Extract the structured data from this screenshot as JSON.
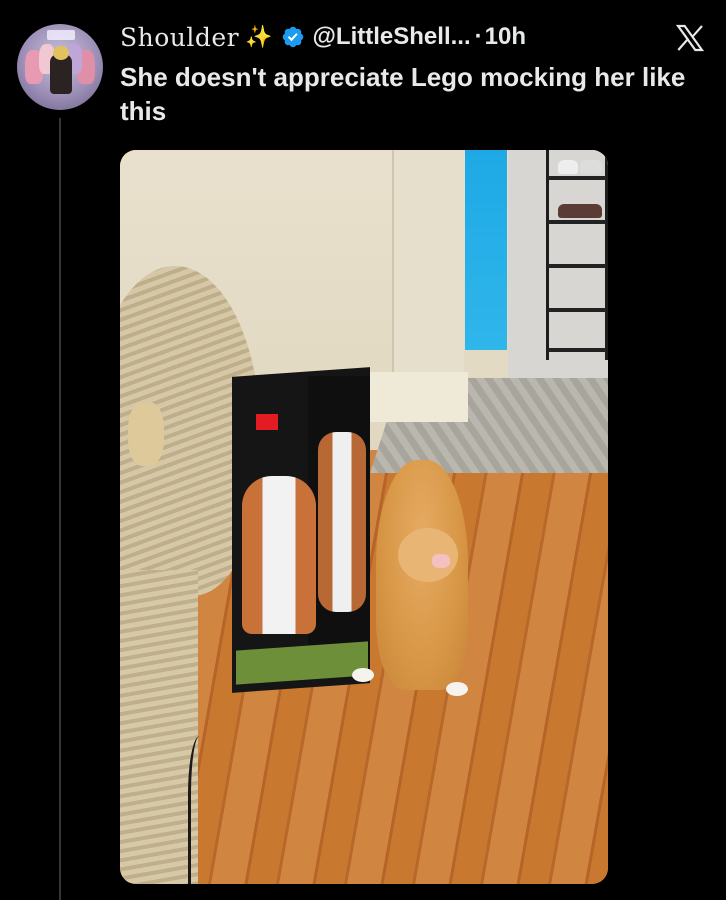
{
  "tweet": {
    "author_name": "Shoulder",
    "author_emoji": "✨",
    "handle": "@LittleShell...",
    "separator": "·",
    "timestamp": "10h",
    "text": "She doesn't appreciate Lego mocking her like this"
  },
  "icons": {
    "verified": "verified-badge-icon",
    "logo": "x-logo-icon",
    "sparkle": "sparkles-icon"
  },
  "colors": {
    "background": "#000000",
    "text": "#e7e9ea",
    "verified_blue": "#1d9bf0"
  }
}
